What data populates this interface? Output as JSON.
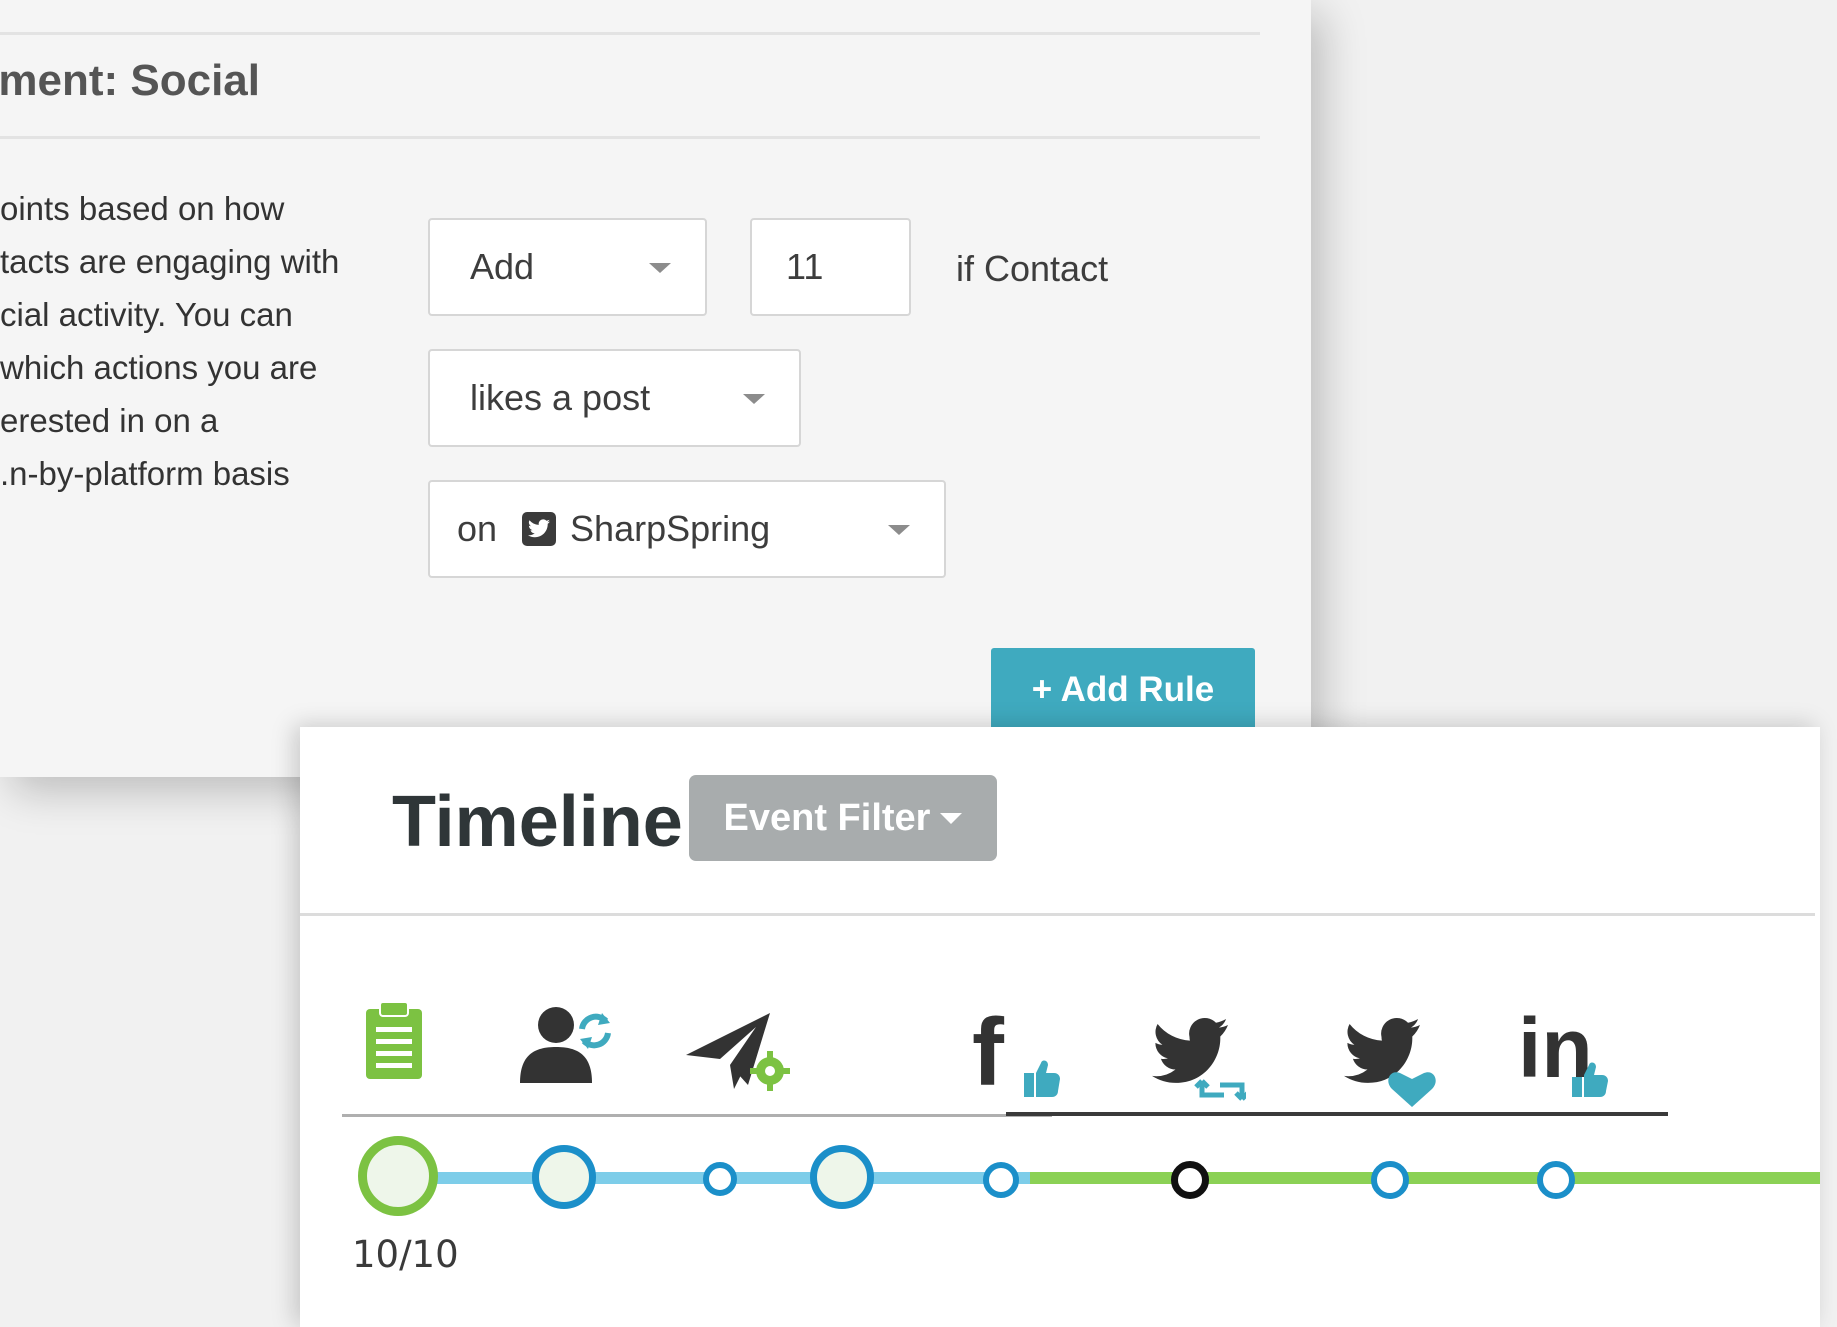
{
  "rule_panel": {
    "title": "ement: Social",
    "description_lines": [
      "oints based on how",
      "tacts are engaging with",
      "cial activity. You can",
      "which actions you are",
      "erested in on a",
      "n-by-platform basis."
    ],
    "action_select": {
      "value": "Add"
    },
    "points_input": {
      "value": "11"
    },
    "condition_label": "if Contact",
    "event_select": {
      "value": "likes a post"
    },
    "account_select": {
      "prefix": "on",
      "value": "SharpSpring",
      "icon": "twitter-icon"
    },
    "add_rule_button": "+ Add Rule"
  },
  "timeline": {
    "title": "Timeline",
    "event_filter_label": "Event Filter",
    "icons": [
      "clipboard-icon",
      "contact-update-icon",
      "email-send-icon",
      "facebook-like-icon",
      "twitter-retweet-icon",
      "twitter-favorite-icon",
      "linkedin-like-icon"
    ],
    "date_label": "10/10",
    "colors": {
      "green": "#7cc242",
      "blue": "#1b8fc9",
      "teal": "#3faabf",
      "dark": "#3a3a3a"
    }
  }
}
